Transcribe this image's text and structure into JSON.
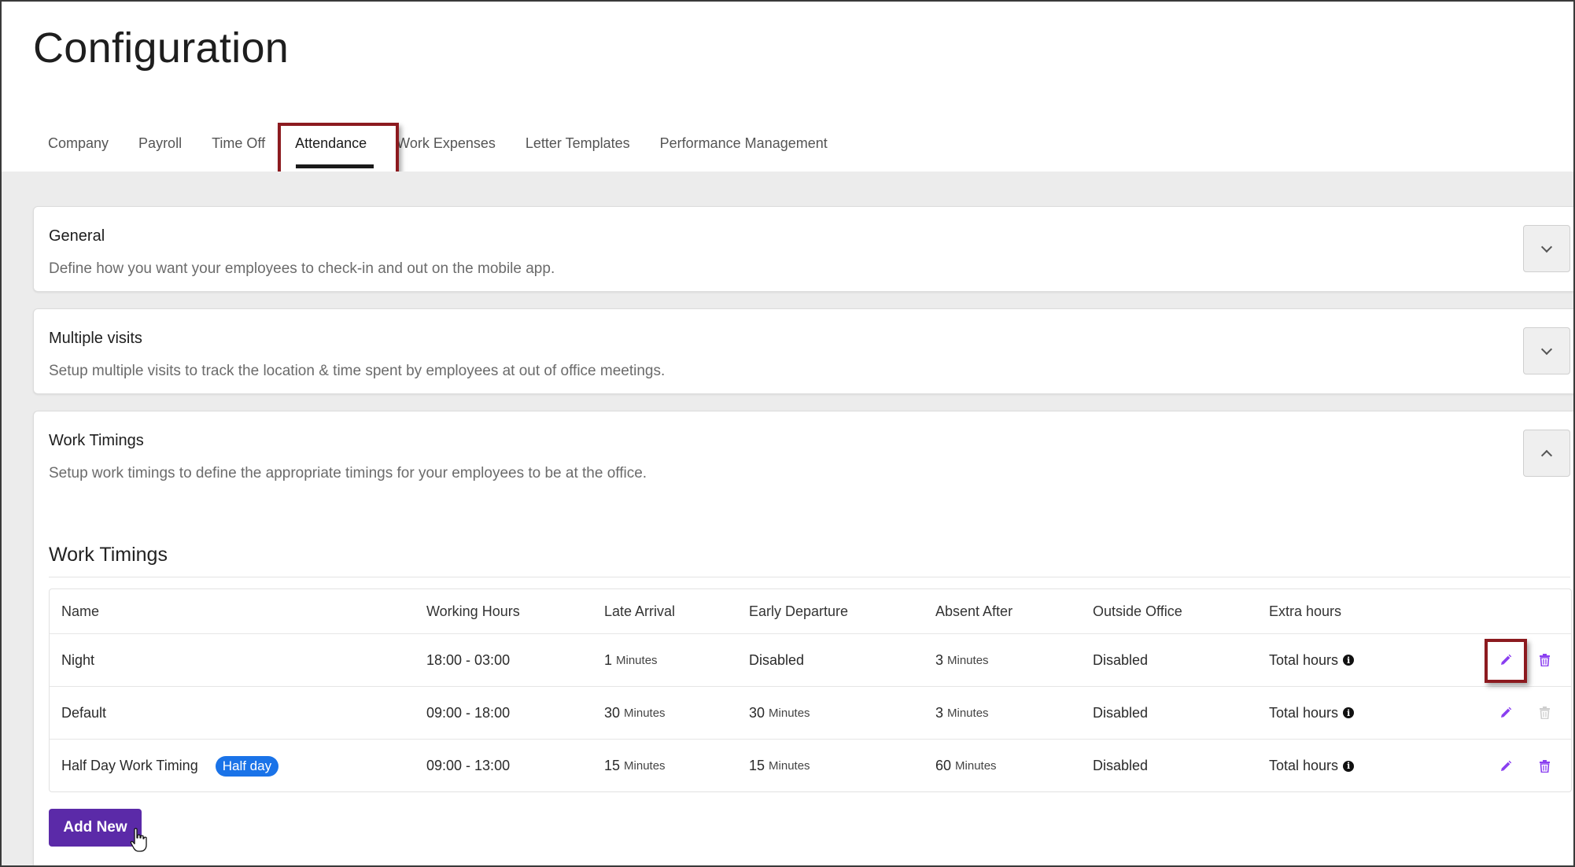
{
  "page": {
    "title": "Configuration"
  },
  "tabs": [
    {
      "label": "Company",
      "active": false
    },
    {
      "label": "Payroll",
      "active": false
    },
    {
      "label": "Time Off",
      "active": false
    },
    {
      "label": "Attendance",
      "active": true
    },
    {
      "label": "Work Expenses",
      "active": false
    },
    {
      "label": "Letter Templates",
      "active": false
    },
    {
      "label": "Performance Management",
      "active": false
    }
  ],
  "sections": {
    "general": {
      "title": "General",
      "description": "Define how you want your employees to check-in and out on the mobile app.",
      "expanded": false
    },
    "multiple_visits": {
      "title": "Multiple visits",
      "description": "Setup multiple visits to track the location & time spent by employees at out of office meetings.",
      "expanded": false
    },
    "work_timings": {
      "title": "Work Timings",
      "description": "Setup work timings to define the appropriate timings for your employees to be at the office.",
      "expanded": true
    }
  },
  "work_timings": {
    "heading": "Work Timings",
    "columns": {
      "name": "Name",
      "working_hours": "Working Hours",
      "late_arrival": "Late Arrival",
      "early_departure": "Early Departure",
      "absent_after": "Absent After",
      "outside_office": "Outside Office",
      "extra_hours": "Extra hours"
    },
    "rows": [
      {
        "name": "Night",
        "badge": "",
        "working_hours": "18:00 - 03:00",
        "late_arrival": {
          "value": "1",
          "unit": "Minutes"
        },
        "early_departure": {
          "value": "Disabled",
          "unit": ""
        },
        "absent_after": {
          "value": "3",
          "unit": "Minutes"
        },
        "outside_office": "Disabled",
        "extra_hours": "Total hours",
        "delete_enabled": true
      },
      {
        "name": "Default",
        "badge": "",
        "working_hours": "09:00 - 18:00",
        "late_arrival": {
          "value": "30",
          "unit": "Minutes"
        },
        "early_departure": {
          "value": "30",
          "unit": "Minutes"
        },
        "absent_after": {
          "value": "3",
          "unit": "Minutes"
        },
        "outside_office": "Disabled",
        "extra_hours": "Total hours",
        "delete_enabled": false
      },
      {
        "name": "Half Day Work Timing",
        "badge": "Half day",
        "working_hours": "09:00 - 13:00",
        "late_arrival": {
          "value": "15",
          "unit": "Minutes"
        },
        "early_departure": {
          "value": "15",
          "unit": "Minutes"
        },
        "absent_after": {
          "value": "60",
          "unit": "Minutes"
        },
        "outside_office": "Disabled",
        "extra_hours": "Total hours",
        "delete_enabled": true
      }
    ],
    "add_button_label": "Add New"
  },
  "colors": {
    "primary_button": "#5b2aa8",
    "action_icon": "#8a3ff0",
    "action_icon_disabled": "#cfcfcf",
    "badge": "#1a73e8",
    "highlight_box": "#8c1a1f"
  }
}
